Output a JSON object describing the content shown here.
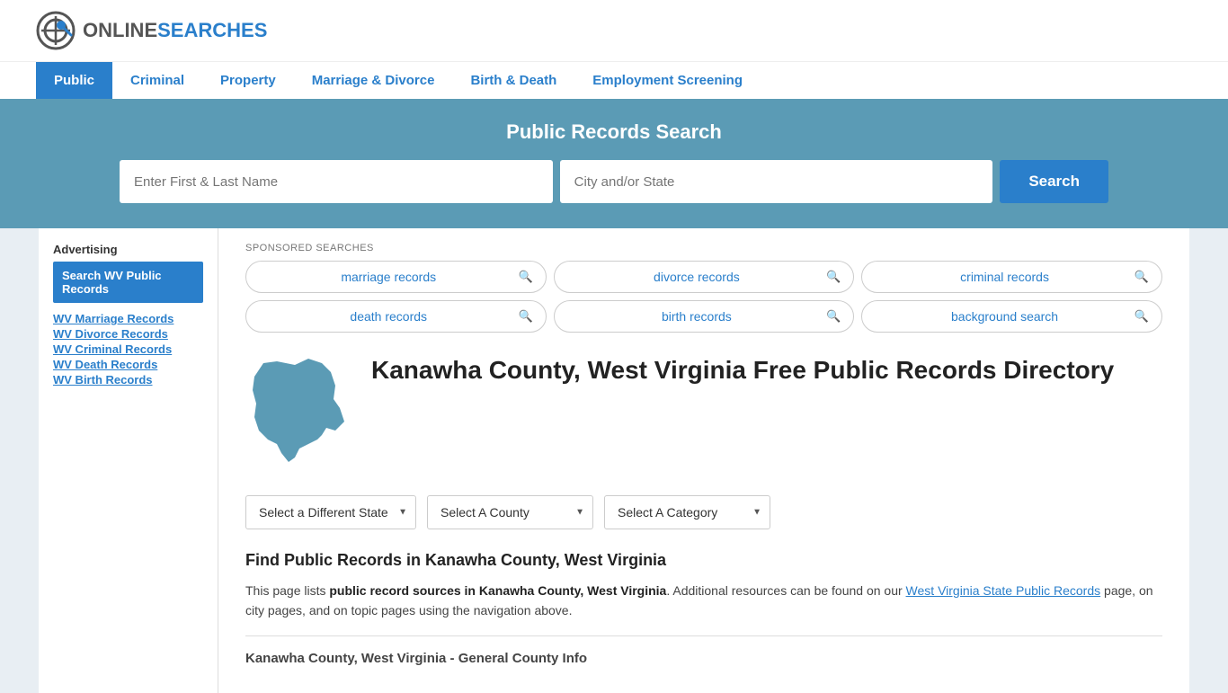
{
  "header": {
    "logo_text_normal": "ONLINE",
    "logo_text_accent": "SEARCHES",
    "nav_items": [
      {
        "label": "Public",
        "active": true
      },
      {
        "label": "Criminal",
        "active": false
      },
      {
        "label": "Property",
        "active": false
      },
      {
        "label": "Marriage & Divorce",
        "active": false
      },
      {
        "label": "Birth & Death",
        "active": false
      },
      {
        "label": "Employment Screening",
        "active": false
      }
    ]
  },
  "search_banner": {
    "title": "Public Records Search",
    "name_placeholder": "Enter First & Last Name",
    "location_placeholder": "City and/or State",
    "button_label": "Search"
  },
  "sponsored": {
    "label": "SPONSORED SEARCHES",
    "items": [
      "marriage records",
      "divorce records",
      "criminal records",
      "death records",
      "birth records",
      "background search"
    ]
  },
  "page": {
    "title": "Kanawha County, West Virginia Free Public Records Directory",
    "find_title": "Find Public Records in Kanawha County, West Virginia",
    "find_text_part1": "This page lists ",
    "find_text_bold": "public record sources in Kanawha County, West Virginia",
    "find_text_part2": ". Additional resources can be found on our ",
    "find_link_text": "West Virginia State Public Records",
    "find_text_part3": " page, on city pages, and on topic pages using the navigation above.",
    "section_subtitle": "Kanawha County, West Virginia - General County Info"
  },
  "dropdowns": {
    "state_label": "Select a Different State",
    "county_label": "Select A County",
    "category_label": "Select A Category"
  },
  "sidebar": {
    "ad_label": "Advertising",
    "ad_button": "Search WV Public Records",
    "links": [
      "WV Marriage Records",
      "WV Divorce Records",
      "WV Criminal Records",
      "WV Death Records",
      "WV Birth Records"
    ]
  }
}
